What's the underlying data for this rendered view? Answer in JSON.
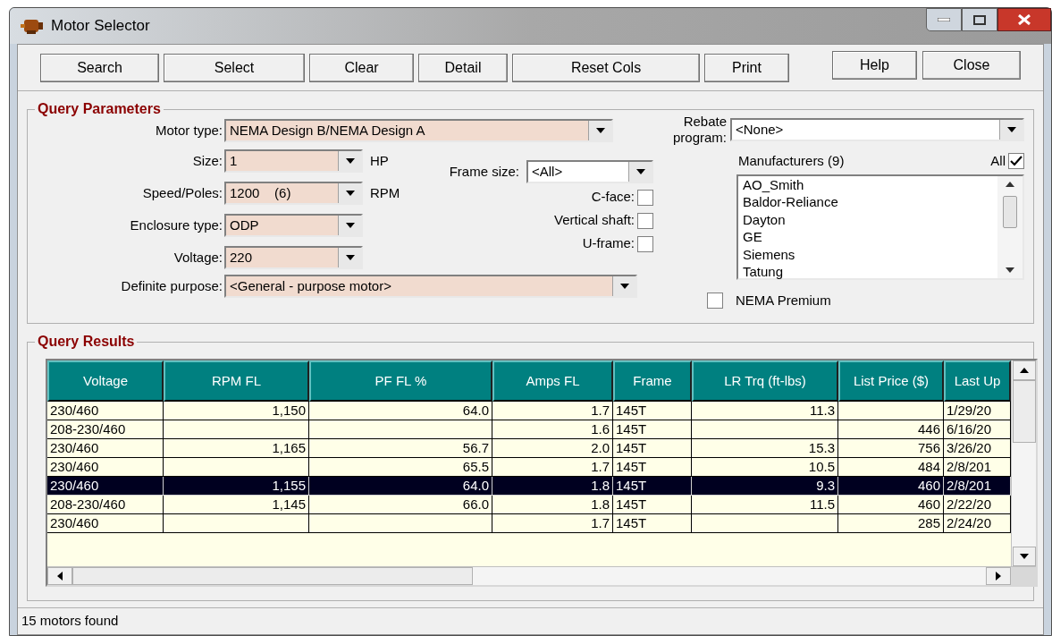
{
  "window": {
    "title": "Motor Selector"
  },
  "toolbar": {
    "left": [
      "Search",
      "Select",
      "Clear",
      "Detail",
      "Reset Cols",
      "Print"
    ],
    "right": [
      "Help",
      "Close"
    ]
  },
  "query_parameters": {
    "title": "Query Parameters",
    "motor_type": {
      "label": "Motor type:",
      "value": "NEMA Design B/NEMA Design A"
    },
    "rows": [
      {
        "label": "Size:",
        "value": "1",
        "unit": "HP"
      },
      {
        "label": "Speed/Poles:",
        "value": "1200    (6)",
        "unit": "RPM"
      },
      {
        "label": "Enclosure type:",
        "value": "ODP"
      },
      {
        "label": "Voltage:",
        "value": "220"
      }
    ],
    "definite_purpose": {
      "label": "Definite purpose:",
      "value": "<General - purpose motor>"
    },
    "frame_size": {
      "label": "Frame size:",
      "value": "<All>"
    },
    "options": [
      {
        "label": "C-face:",
        "checked": false
      },
      {
        "label": "Vertical shaft:",
        "checked": false
      },
      {
        "label": "U-frame:",
        "checked": false
      }
    ],
    "rebate": {
      "label": "Rebate program:",
      "value": "<None>"
    },
    "manufacturers": {
      "label": "Manufacturers (9)",
      "all_label": "All",
      "all_checked": true,
      "items": [
        "AO_Smith",
        "Baldor-Reliance",
        "Dayton",
        "GE",
        "Siemens",
        "Tatung"
      ]
    },
    "nema_premium": {
      "label": "NEMA Premium",
      "checked": false
    }
  },
  "query_results": {
    "title": "Query Results",
    "columns": [
      "Voltage",
      "RPM FL",
      "PF FL %",
      "Amps FL",
      "Frame",
      "LR Trq (ft-lbs)",
      "List Price ($)",
      "Last Up"
    ],
    "rows": [
      {
        "selected": false,
        "cells": [
          "230/460",
          "1,150",
          "64.0",
          "1.7",
          "145T",
          "11.3",
          "",
          "1/29/20"
        ]
      },
      {
        "selected": false,
        "cells": [
          "208-230/460",
          "",
          "",
          "1.6",
          "145T",
          "",
          "446",
          "6/16/20"
        ]
      },
      {
        "selected": false,
        "cells": [
          "230/460",
          "1,165",
          "56.7",
          "2.0",
          "145T",
          "15.3",
          "756",
          "3/26/20"
        ]
      },
      {
        "selected": false,
        "cells": [
          "230/460",
          "",
          "65.5",
          "1.7",
          "145T",
          "10.5",
          "484",
          "2/8/201"
        ]
      },
      {
        "selected": true,
        "cells": [
          "230/460",
          "1,155",
          "64.0",
          "1.8",
          "145T",
          "9.3",
          "460",
          "2/8/201"
        ]
      },
      {
        "selected": false,
        "cells": [
          "208-230/460",
          "1,145",
          "66.0",
          "1.8",
          "145T",
          "11.5",
          "460",
          "2/22/20"
        ]
      },
      {
        "selected": false,
        "cells": [
          "230/460",
          "",
          "",
          "1.7",
          "145T",
          "",
          "285",
          "2/24/20"
        ]
      }
    ]
  },
  "status_bar": "15 motors found"
}
